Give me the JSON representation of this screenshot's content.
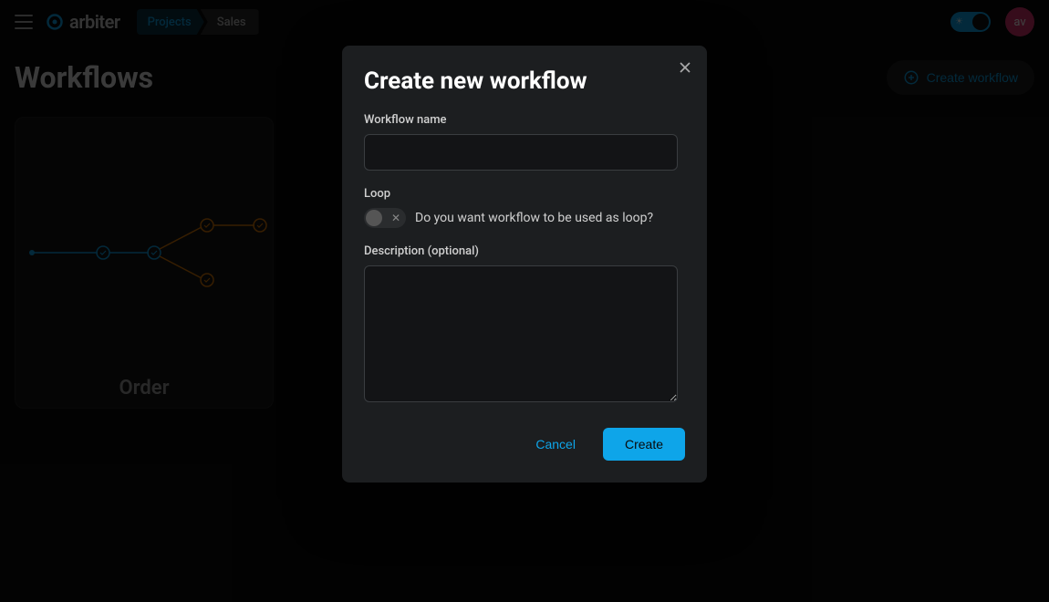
{
  "header": {
    "logo_text": "arbiter",
    "breadcrumb": [
      "Projects",
      "Sales"
    ],
    "avatar_initials": "av"
  },
  "page": {
    "title": "Workflows",
    "create_button_label": "Create workflow"
  },
  "cards": [
    {
      "title": "Order"
    }
  ],
  "modal": {
    "title": "Create new workflow",
    "fields": {
      "name_label": "Workflow name",
      "name_value": "",
      "loop_label": "Loop",
      "loop_help": "Do you want workflow to be used as loop?",
      "loop_value": false,
      "description_label": "Description (optional)",
      "description_value": ""
    },
    "buttons": {
      "cancel": "Cancel",
      "create": "Create"
    }
  }
}
